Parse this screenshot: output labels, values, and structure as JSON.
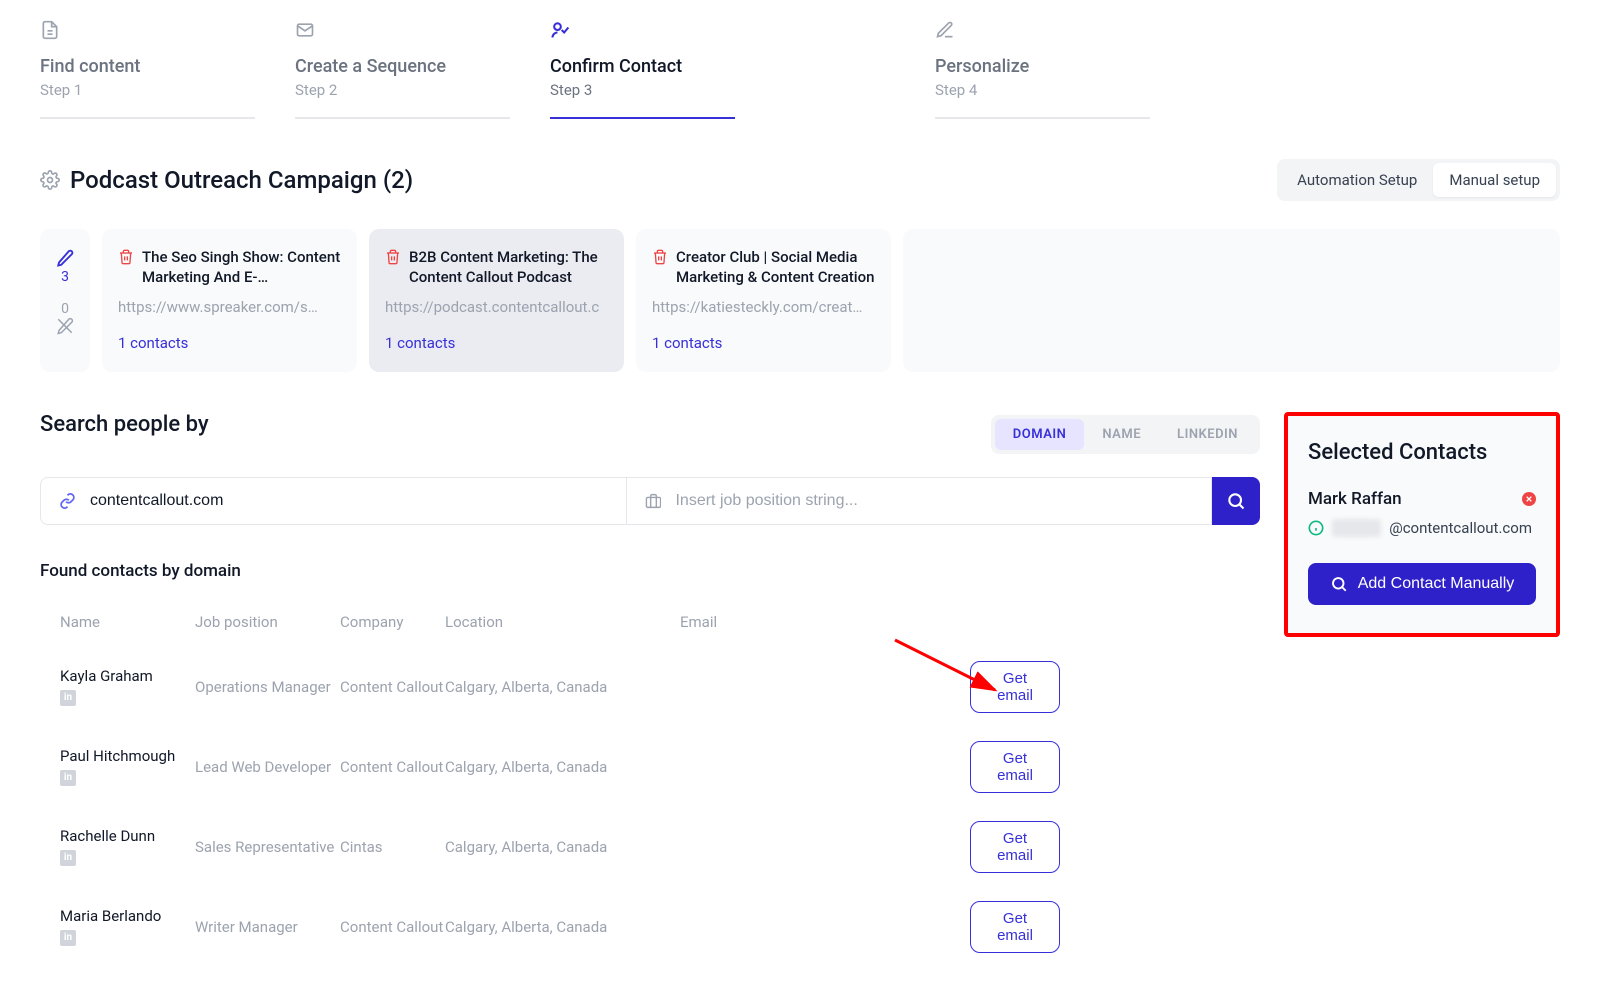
{
  "stepper": [
    {
      "title": "Find content",
      "label": "Step 1"
    },
    {
      "title": "Create a Sequence",
      "label": "Step 2"
    },
    {
      "title": "Confirm Contact",
      "label": "Step 3"
    },
    {
      "title": "Personalize",
      "label": "Step 4"
    }
  ],
  "campaign": {
    "title": "Podcast Outreach Campaign (2)"
  },
  "setup_toggle": {
    "automation": "Automation Setup",
    "manual": "Manual setup"
  },
  "summary": {
    "pencil_count": "3",
    "missing_count": "0"
  },
  "cards": [
    {
      "title": "The Seo Singh Show: Content Marketing And E-Commerce…",
      "url": "https://www.spreaker.com/s…",
      "contacts": "1 contacts"
    },
    {
      "title": "B2B Content Marketing: The Content Callout Podcast",
      "url": "https://podcast.contentcallout.c",
      "contacts": "1 contacts"
    },
    {
      "title": "Creator Club | Social Media Marketing & Content Creation",
      "url": "https://katiesteckly.com/creat…",
      "contacts": "1 contacts"
    }
  ],
  "search": {
    "title": "Search people by",
    "tabs": {
      "domain": "DOMAIN",
      "name": "NAME",
      "linkedin": "LINKEDIN"
    },
    "domain_value": "contentcallout.com",
    "job_placeholder": "Insert job position string..."
  },
  "found": {
    "title": "Found contacts by domain",
    "headers": {
      "name": "Name",
      "job": "Job position",
      "company": "Company",
      "location": "Location",
      "email": "Email"
    },
    "get_email_label": "Get email",
    "rows": [
      {
        "name": "Kayla Graham",
        "job": "Operations Manager",
        "company": "Content Callout",
        "location": "Calgary, Alberta, Canada"
      },
      {
        "name": "Paul Hitchmough",
        "job": "Lead Web Developer",
        "company": "Content Callout",
        "location": "Calgary, Alberta, Canada"
      },
      {
        "name": "Rachelle Dunn",
        "job": "Sales Representative",
        "company": "Cintas",
        "location": "Calgary, Alberta, Canada"
      },
      {
        "name": "Maria Berlando",
        "job": "Writer Manager",
        "company": "Content Callout",
        "location": "Calgary, Alberta, Canada"
      }
    ]
  },
  "selected": {
    "title": "Selected Contacts",
    "name": "Mark Raffan",
    "email_domain": "@contentcallout.com",
    "add_manual": "Add Contact Manually"
  }
}
